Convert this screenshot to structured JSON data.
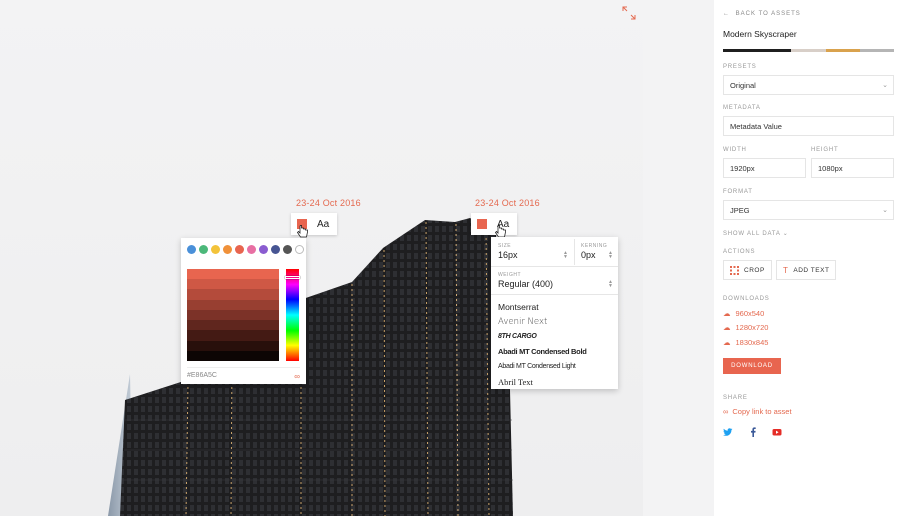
{
  "canvas": {
    "date_labels": [
      "23-24 Oct 2016",
      "23-24 Oct 2016"
    ],
    "chip_text": [
      "Aa",
      "Aa"
    ],
    "color_picker": {
      "swatches": [
        "#4a90d9",
        "#4cb87a",
        "#f3c33a",
        "#f0913a",
        "#e8654f",
        "#e86fa3",
        "#8a5cd0",
        "#475593",
        "#555555",
        "#ffffff"
      ],
      "hex_value": "#E86A5C",
      "shades": [
        "#e8654f",
        "#cf5845",
        "#b44b3b",
        "#983f31",
        "#7c3228",
        "#60261e",
        "#441a14",
        "#280f0b",
        "#0d0504"
      ]
    },
    "type_panel": {
      "size_label": "SIZE",
      "size_value": "16px",
      "kerning_label": "KERNING",
      "kerning_value": "0px",
      "weight_label": "WEIGHT",
      "weight_value": "Regular (400)",
      "fonts": [
        "Montserrat",
        "Avenir Next",
        "8TH CARGO",
        "Abadi MT Condensed Bold",
        "Abadi MT Condensed Light",
        "Abril Text"
      ]
    }
  },
  "sidebar": {
    "back_label": "BACK TO ASSETS",
    "asset_title": "Modern Skyscraper",
    "palette": [
      "#1f1f1f",
      "#1f1f1f",
      "#d8cfc8",
      "#d9a24d",
      "#b5b5b5"
    ],
    "presets_label": "PRESETS",
    "presets_value": "Original",
    "metadata_label": "METADATA",
    "metadata_value": "Metadata Value",
    "width_label": "WIDTH",
    "width_value": "1920px",
    "height_label": "HEIGHT",
    "height_value": "1080px",
    "format_label": "FORMAT",
    "format_value": "JPEG",
    "show_all_label": "SHOW ALL DATA",
    "actions_label": "ACTIONS",
    "crop_label": "CROP",
    "add_text_label": "ADD TEXT",
    "downloads_label": "DOWNLOADS",
    "downloads": [
      "960x540",
      "1280x720",
      "1830x845"
    ],
    "download_button": "DOWNLOAD",
    "share_label": "SHARE",
    "copy_link_label": "Copy link to asset",
    "accent": "#e8654f"
  }
}
